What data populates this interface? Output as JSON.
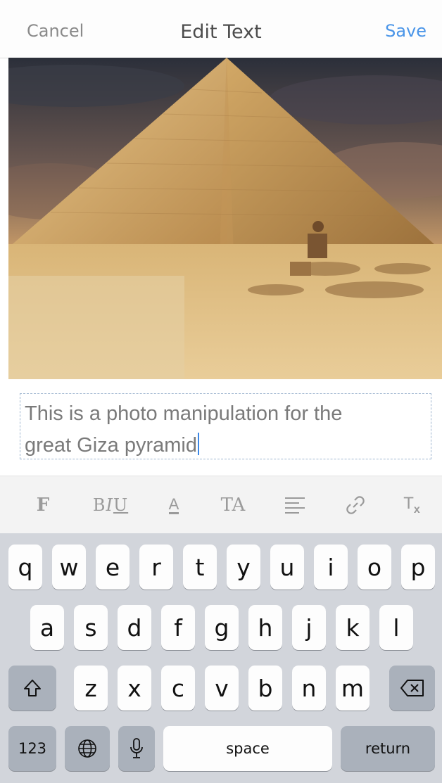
{
  "nav": {
    "cancel_label": "Cancel",
    "title": "Edit Text",
    "save_label": "Save"
  },
  "photo": {
    "subject": "pyramid-photo"
  },
  "editor": {
    "line1": "This is a photo manipulation for the",
    "line2": "great Giza pyramid"
  },
  "toolbar": {
    "items": [
      {
        "name": "font",
        "glyph": "F"
      },
      {
        "name": "bold-italic-underline",
        "glyph": "B I U"
      },
      {
        "name": "text-color",
        "glyph": "A"
      },
      {
        "name": "text-case",
        "glyph": "TA"
      },
      {
        "name": "alignment",
        "glyph": "≡"
      },
      {
        "name": "link",
        "glyph": "🔗"
      },
      {
        "name": "clear-format",
        "glyph": "Tx"
      }
    ]
  },
  "keyboard": {
    "row1": [
      "q",
      "w",
      "e",
      "r",
      "t",
      "y",
      "u",
      "i",
      "o",
      "p"
    ],
    "row2": [
      "a",
      "s",
      "d",
      "f",
      "g",
      "h",
      "j",
      "k",
      "l"
    ],
    "row3": [
      "z",
      "x",
      "c",
      "v",
      "b",
      "n",
      "m"
    ],
    "numbers_label": "123",
    "space_label": "space",
    "return_label": "return"
  },
  "colors": {
    "accent": "#4a95e8",
    "keyboard_bg": "#d2d5db"
  }
}
